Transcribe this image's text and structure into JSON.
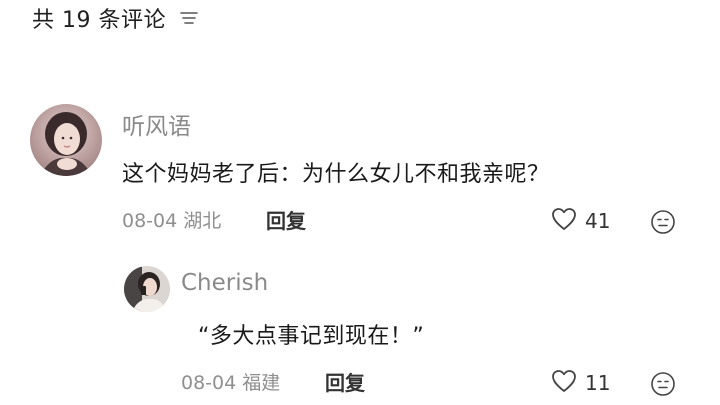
{
  "header": {
    "title": "共 19 条评论",
    "sort_icon": "sort-lines-icon"
  },
  "comments": [
    {
      "username": "听风语",
      "text": "这个妈妈老了后：为什么女儿不和我亲呢？",
      "date": "08-04",
      "location": "湖北",
      "reply_label": "回复",
      "likes": "41",
      "icon_like": "heart-outline-icon",
      "icon_more": "emoji-face-icon"
    },
    {
      "username": "Cherish",
      "text": "“多大点事记到现在！”",
      "date": "08-04",
      "location": "福建",
      "reply_label": "回复",
      "likes": "11",
      "icon_like": "heart-outline-icon",
      "icon_more": "emoji-face-icon"
    }
  ]
}
